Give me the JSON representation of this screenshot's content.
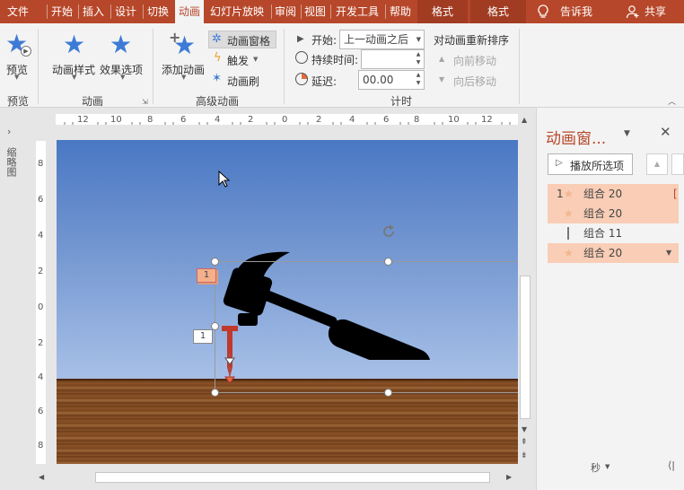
{
  "tabs": [
    "文件",
    "开始",
    "插入",
    "设计",
    "切换",
    "动画",
    "幻灯片放映",
    "审阅",
    "视图",
    "开发工具",
    "帮助",
    "格式",
    "格式",
    "告诉我",
    "共享"
  ],
  "ribbon": {
    "preview_label": "预览",
    "preview_group": "预览",
    "anim_style_label": "动画样式",
    "effect_options_label": "效果选项",
    "animation_group": "动画",
    "add_anim_label": "添加动画",
    "anim_pane_label": "动画窗格",
    "trigger_label": "触发",
    "anim_painter_label": "动画刷",
    "advanced_group": "高级动画",
    "start_label": "开始:",
    "start_value": "上一动画之后",
    "duration_label": "持续时间:",
    "duration_value": "",
    "delay_label": "延迟:",
    "delay_value": "00.00",
    "timing_group": "计时",
    "reorder_label": "对动画重新排序",
    "move_earlier": "向前移动",
    "move_later": "向后移动"
  },
  "left_strip": {
    "thumbnails_label": "缩略图"
  },
  "rulers": {
    "h": [
      "12",
      "10",
      "8",
      "6",
      "4",
      "2",
      "0",
      "2",
      "4",
      "6",
      "8",
      "10",
      "12"
    ],
    "v": [
      "8",
      "6",
      "4",
      "2",
      "0",
      "2",
      "4",
      "6",
      "8"
    ]
  },
  "slide": {
    "tag_top": "1",
    "tag_left": "1"
  },
  "pane": {
    "title": "动画窗...",
    "play_all": "播放所选项",
    "items": [
      {
        "num": "1",
        "name": "组合 20"
      },
      {
        "num": "",
        "name": "组合 20"
      },
      {
        "num": "",
        "name": "组合 11"
      },
      {
        "num": "",
        "name": "组合 20"
      }
    ],
    "seconds_label": "秒"
  },
  "colors": {
    "accent": "#b7472a",
    "highlight": "#f9cdb6",
    "star": "#3e7bd6"
  }
}
